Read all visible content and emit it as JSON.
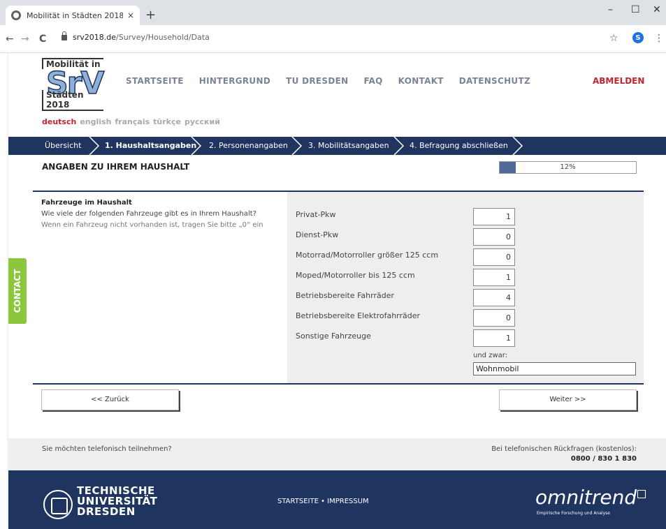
{
  "browser": {
    "tab_title": "Mobilität in Städten 2018",
    "tab_close": "×",
    "new_tab": "+",
    "url_domain": "srv2018.de",
    "url_path": "/Survey/Household/Data",
    "profile_initial": "S",
    "minimize": "–",
    "maximize": "☐",
    "close": "✕",
    "back": "←",
    "forward": "→",
    "reload": "C",
    "star": "☆",
    "menu": "⋮"
  },
  "logo": {
    "top": "Mobilität in",
    "mark": "SrV",
    "bottom": "Städten 2018"
  },
  "nav": {
    "items": [
      "STARTSEITE",
      "HINTERGRUND",
      "TU DRESDEN",
      "FAQ",
      "KONTAKT",
      "DATENSCHUTZ"
    ],
    "logout": "ABMELDEN"
  },
  "languages": {
    "items": [
      "deutsch",
      "english",
      "français",
      "türkçe",
      "русский"
    ],
    "active": "deutsch"
  },
  "steps": {
    "items": [
      "Übersicht",
      "1. Haushaltsangaben",
      "2. Personenangaben",
      "3. Mobilitätsangaben",
      "4. Befragung abschließen"
    ],
    "active_index": 1
  },
  "section": {
    "title": "ANGABEN ZU IHREM HAUSHALT",
    "progress_label": "12%",
    "progress_value": 0.12
  },
  "question": {
    "title": "Fahrzeuge im Haushalt",
    "text": "Wie viele der folgenden Fahrzeuge gibt es in Ihrem Haushalt?",
    "hint": "Wenn ein Fahrzeug nicht vorhanden ist, tragen Sie bitte „0“ ein"
  },
  "vehicles": [
    {
      "label": "Privat-Pkw",
      "value": "1"
    },
    {
      "label": "Dienst-Pkw",
      "value": "0"
    },
    {
      "label": "Motorrad/Motorroller größer 125 ccm",
      "value": "0"
    },
    {
      "label": "Moped/Motorroller bis 125 ccm",
      "value": "1"
    },
    {
      "label": "Betriebsbereite Fahrräder",
      "value": "4"
    },
    {
      "label": "Betriebsbereite Elektrofahrräder",
      "value": "0"
    },
    {
      "label": "Sonstige Fahrzeuge",
      "value": "1"
    }
  ],
  "other": {
    "label": "und zwar:",
    "value": "Wohnmobil"
  },
  "buttons": {
    "back": "<< Zurück",
    "next": "Weiter >>"
  },
  "contact": {
    "tab_label": "CONTACT",
    "phone_question": "Sie möchten telefonisch teilnehmen?",
    "hotline_label": "Bei telefonischen Rückfragen (kostenlos):",
    "hotline_number": "0800 / 830 1 830"
  },
  "footer": {
    "tud_line1": "TECHNISCHE",
    "tud_line2": "UNIVERSITÄT",
    "tud_line3": "DRESDEN",
    "links": "STARTSEITE • IMPRESSUM",
    "brand": "omnitrend",
    "brand_sub": "Empirische Forschung und Analyse"
  },
  "colors": {
    "primary": "#1f3560",
    "accent_red": "#c0262d",
    "contact_green": "#8cc63f",
    "logo_blue": "#8db1d8"
  }
}
